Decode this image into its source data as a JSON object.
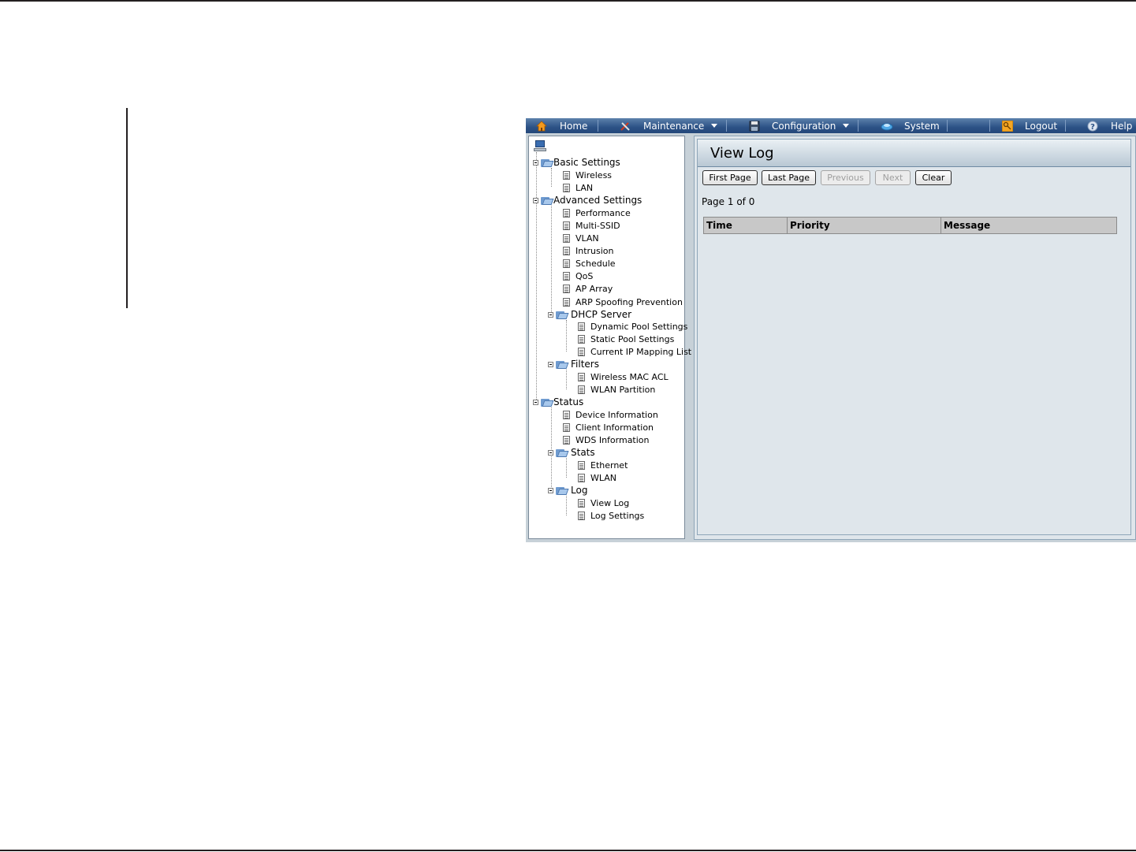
{
  "menu": {
    "items": [
      {
        "label": "Home",
        "icon": "home-icon"
      },
      {
        "label": "Maintenance",
        "icon": "tools-icon",
        "dropdown": true
      },
      {
        "label": "Configuration",
        "icon": "save-icon",
        "dropdown": true
      },
      {
        "label": "System",
        "icon": "system-icon"
      },
      {
        "label": "Logout",
        "icon": "key-icon"
      },
      {
        "label": "Help",
        "icon": "help-icon"
      }
    ]
  },
  "tree": {
    "basic_settings": "Basic Settings",
    "wireless": "Wireless",
    "lan": "LAN",
    "advanced_settings": "Advanced Settings",
    "performance": "Performance",
    "multi_ssid": "Multi-SSID",
    "vlan": "VLAN",
    "intrusion": "Intrusion",
    "schedule": "Schedule",
    "qos": "QoS",
    "ap_array": "AP Array",
    "arp": "ARP Spoofing Prevention",
    "dhcp_server": "DHCP Server",
    "dynamic_pool": "Dynamic Pool Settings",
    "static_pool": "Static Pool Settings",
    "ip_mapping": "Current IP Mapping List",
    "filters": "Filters",
    "mac_acl": "Wireless MAC ACL",
    "wlan_partition": "WLAN Partition",
    "status": "Status",
    "device_info": "Device Information",
    "client_info": "Client Information",
    "wds_info": "WDS Information",
    "stats": "Stats",
    "ethernet": "Ethernet",
    "wlan": "WLAN",
    "log": "Log",
    "view_log": "View Log",
    "log_settings": "Log Settings"
  },
  "content": {
    "title": "View Log",
    "buttons": {
      "first_page": "First Page",
      "last_page": "Last Page",
      "previous": "Previous",
      "next": "Next",
      "clear": "Clear"
    },
    "page_info": "Page 1 of 0",
    "columns": [
      "Time",
      "Priority",
      "Message"
    ]
  },
  "colors": {
    "menubar": "#2c5286",
    "panel_bg": "#dfe6eb",
    "disabled_text": "#9e9e9e"
  }
}
